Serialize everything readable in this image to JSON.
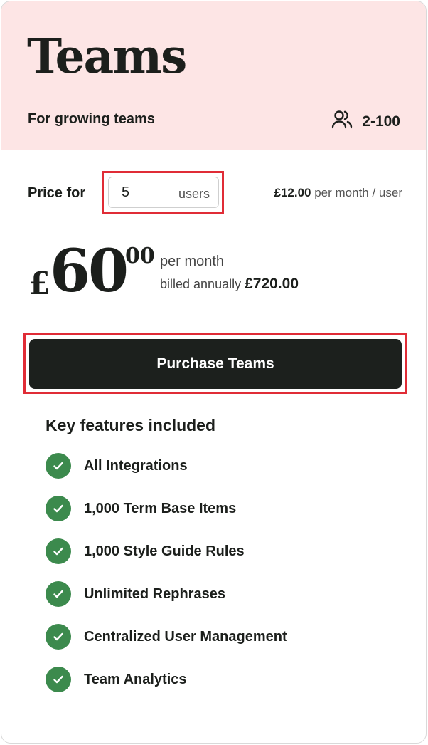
{
  "plan": {
    "title": "Teams",
    "subtitle": "For growing teams",
    "team_size": "2-100",
    "team_icon": "users-icon"
  },
  "pricing": {
    "price_for_label": "Price for",
    "users_value": "5",
    "users_unit": "users",
    "per_user_amount": "£12.00",
    "per_user_text": "per month / user",
    "currency": "£",
    "amount": "60",
    "cents": "00",
    "per_month": "per month",
    "billed_annually_label": "billed annually",
    "annual_total": "£720.00"
  },
  "cta": {
    "label": "Purchase Teams"
  },
  "features": {
    "heading": "Key features included",
    "check_icon": "check-circle-icon",
    "items": [
      "All Integrations",
      "1,000 Term Base Items",
      "1,000 Style Guide Rules",
      "Unlimited Rephrases",
      "Centralized User Management",
      "Team Analytics"
    ]
  },
  "colors": {
    "header_bg": "#fde5e5",
    "button_bg": "#1c201d",
    "check_green": "#3c8a4d",
    "highlight_red": "#e02c36"
  }
}
